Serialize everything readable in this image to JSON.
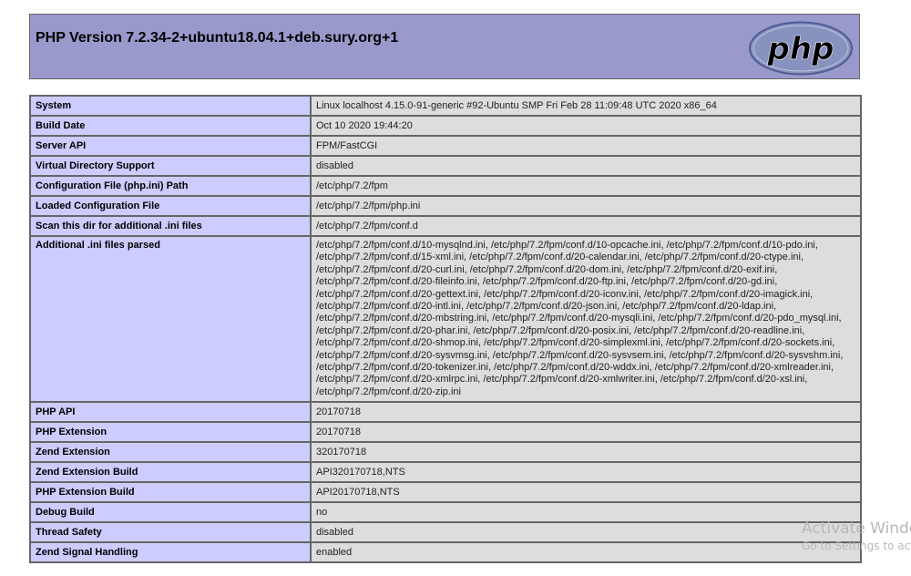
{
  "header": {
    "title": "PHP Version 7.2.34-2+ubuntu18.04.1+deb.sury.org+1",
    "logo_text": "php"
  },
  "rows": [
    {
      "key": "System",
      "value": "Linux localhost 4.15.0-91-generic #92-Ubuntu SMP Fri Feb 28 11:09:48 UTC 2020 x86_64"
    },
    {
      "key": "Build Date",
      "value": "Oct 10 2020 19:44:20"
    },
    {
      "key": "Server API",
      "value": "FPM/FastCGI"
    },
    {
      "key": "Virtual Directory Support",
      "value": "disabled"
    },
    {
      "key": "Configuration File (php.ini) Path",
      "value": "/etc/php/7.2/fpm"
    },
    {
      "key": "Loaded Configuration File",
      "value": "/etc/php/7.2/fpm/php.ini"
    },
    {
      "key": "Scan this dir for additional .ini files",
      "value": "/etc/php/7.2/fpm/conf.d"
    },
    {
      "key": "Additional .ini files parsed",
      "value": "/etc/php/7.2/fpm/conf.d/10-mysqlnd.ini, /etc/php/7.2/fpm/conf.d/10-opcache.ini, /etc/php/7.2/fpm/conf.d/10-pdo.ini, /etc/php/7.2/fpm/conf.d/15-xml.ini, /etc/php/7.2/fpm/conf.d/20-calendar.ini, /etc/php/7.2/fpm/conf.d/20-ctype.ini, /etc/php/7.2/fpm/conf.d/20-curl.ini, /etc/php/7.2/fpm/conf.d/20-dom.ini, /etc/php/7.2/fpm/conf.d/20-exif.ini, /etc/php/7.2/fpm/conf.d/20-fileinfo.ini, /etc/php/7.2/fpm/conf.d/20-ftp.ini, /etc/php/7.2/fpm/conf.d/20-gd.ini, /etc/php/7.2/fpm/conf.d/20-gettext.ini, /etc/php/7.2/fpm/conf.d/20-iconv.ini, /etc/php/7.2/fpm/conf.d/20-imagick.ini, /etc/php/7.2/fpm/conf.d/20-intl.ini, /etc/php/7.2/fpm/conf.d/20-json.ini, /etc/php/7.2/fpm/conf.d/20-ldap.ini, /etc/php/7.2/fpm/conf.d/20-mbstring.ini, /etc/php/7.2/fpm/conf.d/20-mysqli.ini, /etc/php/7.2/fpm/conf.d/20-pdo_mysql.ini, /etc/php/7.2/fpm/conf.d/20-phar.ini, /etc/php/7.2/fpm/conf.d/20-posix.ini, /etc/php/7.2/fpm/conf.d/20-readline.ini, /etc/php/7.2/fpm/conf.d/20-shmop.ini, /etc/php/7.2/fpm/conf.d/20-simplexml.ini, /etc/php/7.2/fpm/conf.d/20-sockets.ini, /etc/php/7.2/fpm/conf.d/20-sysvmsg.ini, /etc/php/7.2/fpm/conf.d/20-sysvsem.ini, /etc/php/7.2/fpm/conf.d/20-sysvshm.ini, /etc/php/7.2/fpm/conf.d/20-tokenizer.ini, /etc/php/7.2/fpm/conf.d/20-wddx.ini, /etc/php/7.2/fpm/conf.d/20-xmlreader.ini, /etc/php/7.2/fpm/conf.d/20-xmlrpc.ini, /etc/php/7.2/fpm/conf.d/20-xmlwriter.ini, /etc/php/7.2/fpm/conf.d/20-xsl.ini, /etc/php/7.2/fpm/conf.d/20-zip.ini"
    },
    {
      "key": "PHP API",
      "value": "20170718"
    },
    {
      "key": "PHP Extension",
      "value": "20170718"
    },
    {
      "key": "Zend Extension",
      "value": "320170718"
    },
    {
      "key": "Zend Extension Build",
      "value": "API320170718,NTS"
    },
    {
      "key": "PHP Extension Build",
      "value": "API20170718,NTS"
    },
    {
      "key": "Debug Build",
      "value": "no"
    },
    {
      "key": "Thread Safety",
      "value": "disabled"
    },
    {
      "key": "Zend Signal Handling",
      "value": "enabled"
    }
  ],
  "watermark": {
    "line1": "Activate Windows",
    "line2": "Go to Settings to activate Windows."
  },
  "colors": {
    "header_bg": "#9999cc",
    "key_bg": "#ccccff",
    "value_bg": "#dddddd",
    "border": "#666666"
  }
}
